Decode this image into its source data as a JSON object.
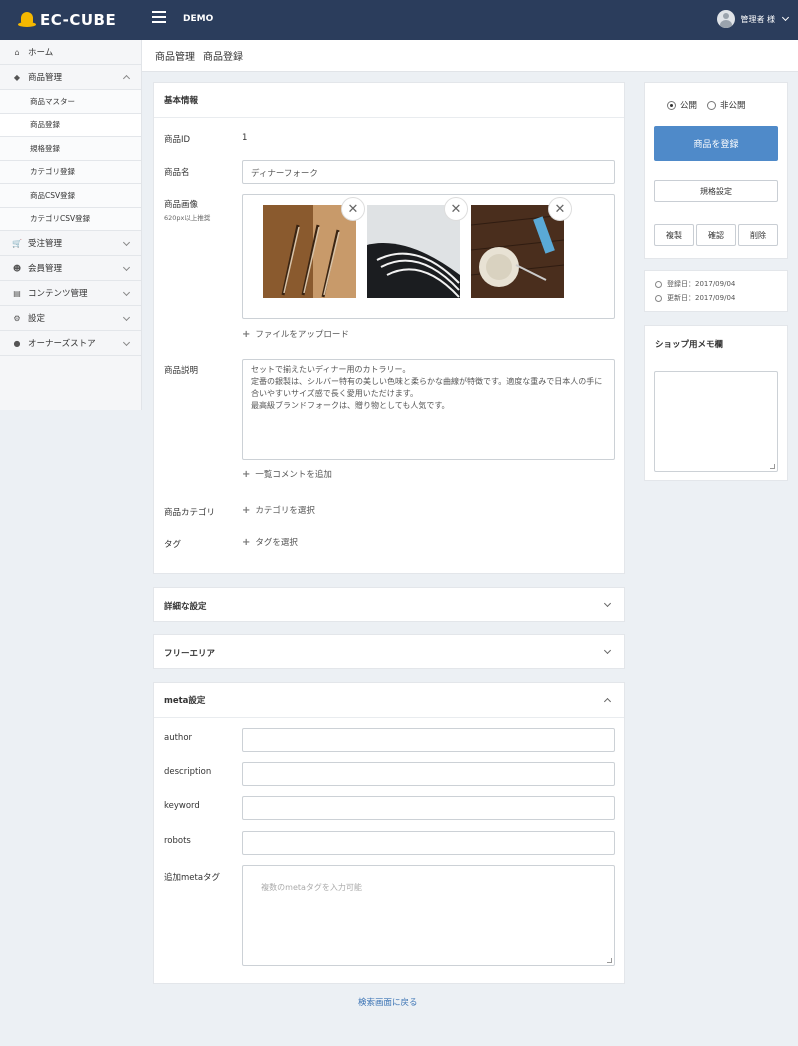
{
  "header": {
    "logo_text": "EC-CUBE",
    "site_name": "DEMO",
    "user_name": "管理者 様"
  },
  "sidebar": {
    "items": [
      {
        "label": "ホーム",
        "icon": "home-icon"
      },
      {
        "label": "商品管理",
        "icon": "tag-icon"
      },
      {
        "label": "受注管理",
        "icon": "cart-icon"
      },
      {
        "label": "会員管理",
        "icon": "users-icon"
      },
      {
        "label": "コンテンツ管理",
        "icon": "file-icon"
      },
      {
        "label": "設定",
        "icon": "gear-icon"
      },
      {
        "label": "オーナーズストア",
        "icon": "info-icon"
      }
    ],
    "sub_items": [
      "商品マスター",
      "商品登録",
      "規格登録",
      "カテゴリ登録",
      "商品CSV登録",
      "カテゴリCSV登録"
    ]
  },
  "breadcrumb": [
    "商品管理",
    "商品登録"
  ],
  "basic": {
    "title": "基本情報",
    "product_id_label": "商品ID",
    "product_id_value": "1",
    "product_name_label": "商品名",
    "product_name_value": "ディナーフォーク",
    "image_label": "商品画像",
    "image_sub": "620px以上推奨",
    "upload_label": "ファイルをアップロード",
    "desc_label": "商品説明",
    "desc_value": "セットで揃えたいディナー用のカトラリー。\n定番の銀製は、シルバー特有の美しい色味と柔らかな曲線が特徴です。適度な重みで日本人の手に合いやすいサイズ感で長く愛用いただけます。\n最高級ブランドフォークは、贈り物としても人気です。",
    "list_comment_label": "一覧コメントを追加",
    "category_label": "商品カテゴリ",
    "category_action": "カテゴリを選択",
    "tag_label": "タグ",
    "tag_action": "タグを選択"
  },
  "sections": {
    "detail": "詳細な設定",
    "free_area": "フリーエリア",
    "meta": "meta設定"
  },
  "meta": {
    "author_label": "author",
    "description_label": "description",
    "keyword_label": "keyword",
    "robots_label": "robots",
    "extra_label": "追加metaタグ",
    "extra_placeholder": "複数のmetaタグを入力可能"
  },
  "right_panel": {
    "public_label": "公開",
    "private_label": "非公開",
    "register_button": "商品を登録",
    "class_button": "規格設定",
    "copy_button": "複製",
    "preview_button": "確認",
    "delete_button": "削除",
    "created_label": "登録日：2017/09/04",
    "updated_label": "更新日：2017/09/04",
    "memo_title": "ショップ用メモ欄"
  },
  "footer": {
    "back_link": "検索画面に戻る"
  },
  "colors": {
    "topbar": "#2b3d5c",
    "primary": "#4f8ac9",
    "logo_accent": "#f5b800"
  }
}
